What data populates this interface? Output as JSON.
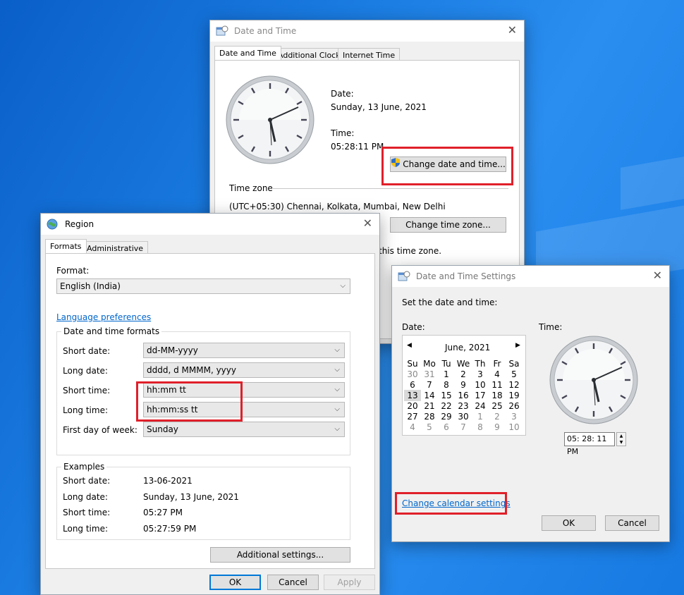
{
  "dt_window": {
    "title": "Date and Time",
    "close": "✕",
    "tabs": [
      "Date and Time",
      "Additional Clocks",
      "Internet Time"
    ],
    "date_label": "Date:",
    "date_value": "Sunday, 13 June, 2021",
    "time_label": "Time:",
    "time_value": "05:28:11 PM",
    "change_dt_button": "Change date and time...",
    "timezone_label": "Time zone",
    "timezone_value": "(UTC+05:30) Chennai, Kolkata, Mumbai, New Delhi",
    "change_tz_button": "Change time zone...",
    "dst_text": "this time zone."
  },
  "region_window": {
    "title": "Region",
    "close": "✕",
    "tabs": [
      "Formats",
      "Administrative"
    ],
    "format_label": "Format:",
    "format_value": "English (India)",
    "language_link": "Language preferences",
    "dt_formats_group": "Date and time formats",
    "rows": [
      {
        "label": "Short date:",
        "value": "dd-MM-yyyy"
      },
      {
        "label": "Long date:",
        "value": "dddd, d MMMM, yyyy"
      },
      {
        "label": "Short time:",
        "value": "hh:mm tt"
      },
      {
        "label": "Long time:",
        "value": "hh:mm:ss tt"
      },
      {
        "label": "First day of week:",
        "value": "Sunday"
      }
    ],
    "examples_group": "Examples",
    "examples": [
      {
        "label": "Short date:",
        "value": "13-06-2021"
      },
      {
        "label": "Long date:",
        "value": "Sunday, 13 June, 2021"
      },
      {
        "label": "Short time:",
        "value": "05:27 PM"
      },
      {
        "label": "Long time:",
        "value": "05:27:59 PM"
      }
    ],
    "additional_button": "Additional settings...",
    "ok": "OK",
    "cancel": "Cancel",
    "apply": "Apply"
  },
  "settings_window": {
    "title": "Date and Time Settings",
    "close": "✕",
    "heading": "Set the date and time:",
    "date_label": "Date:",
    "time_label": "Time:",
    "month": "June, 2021",
    "weekdays": [
      "Su",
      "Mo",
      "Tu",
      "We",
      "Th",
      "Fr",
      "Sa"
    ],
    "days": [
      [
        "30",
        "31",
        "1",
        "2",
        "3",
        "4",
        "5"
      ],
      [
        "6",
        "7",
        "8",
        "9",
        "10",
        "11",
        "12"
      ],
      [
        "13",
        "14",
        "15",
        "16",
        "17",
        "18",
        "19"
      ],
      [
        "20",
        "21",
        "22",
        "23",
        "24",
        "25",
        "26"
      ],
      [
        "27",
        "28",
        "29",
        "30",
        "1",
        "2",
        "3"
      ],
      [
        "4",
        "5",
        "6",
        "7",
        "8",
        "9",
        "10"
      ]
    ],
    "time_value": "05: 28: 11 PM",
    "calendar_link": "Change calendar settings",
    "ok": "OK",
    "cancel": "Cancel"
  },
  "colors": {
    "highlight": "#e0202a",
    "link": "#0066cc",
    "accent": "#0078d7"
  }
}
